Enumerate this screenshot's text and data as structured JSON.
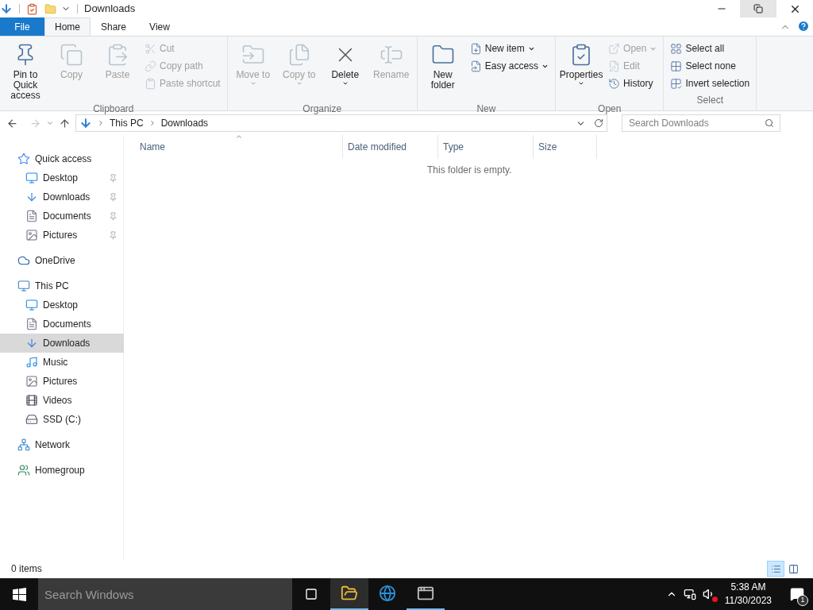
{
  "title_bar": {
    "title": "Downloads"
  },
  "ribbon_tabs": [
    {
      "label": "File",
      "kind": "file",
      "selected": false
    },
    {
      "label": "Home",
      "kind": "tab",
      "selected": true
    },
    {
      "label": "Share",
      "kind": "tab",
      "selected": false
    },
    {
      "label": "View",
      "kind": "tab",
      "selected": false
    }
  ],
  "ribbon_groups": [
    {
      "label": "Clipboard",
      "commands": [
        {
          "label": "Pin to Quick access",
          "kind": "large",
          "disabled": false,
          "dropdown": false
        },
        {
          "label": "Copy",
          "kind": "large",
          "disabled": true,
          "dropdown": false
        },
        {
          "label": "Paste",
          "kind": "large",
          "disabled": true,
          "dropdown": false
        },
        {
          "label": "Cut",
          "kind": "small",
          "disabled": true,
          "dropdown": false
        },
        {
          "label": "Copy path",
          "kind": "small",
          "disabled": true,
          "dropdown": false
        },
        {
          "label": "Paste shortcut",
          "kind": "small",
          "disabled": true,
          "dropdown": false
        }
      ]
    },
    {
      "label": "Organize",
      "commands": [
        {
          "label": "Move to",
          "kind": "large",
          "disabled": true,
          "dropdown": true
        },
        {
          "label": "Copy to",
          "kind": "large",
          "disabled": true,
          "dropdown": true
        },
        {
          "label": "Delete",
          "kind": "large",
          "disabled": false,
          "dropdown": true
        },
        {
          "label": "Rename",
          "kind": "large",
          "disabled": true,
          "dropdown": false
        }
      ]
    },
    {
      "label": "New",
      "commands": [
        {
          "label": "New folder",
          "kind": "large",
          "disabled": false,
          "dropdown": false
        },
        {
          "label": "New item",
          "kind": "small",
          "disabled": false,
          "dropdown": true
        },
        {
          "label": "Easy access",
          "kind": "small",
          "disabled": false,
          "dropdown": true
        }
      ]
    },
    {
      "label": "Open",
      "commands": [
        {
          "label": "Properties",
          "kind": "large",
          "disabled": false,
          "dropdown": true
        },
        {
          "label": "Open",
          "kind": "small",
          "disabled": true,
          "dropdown": true
        },
        {
          "label": "Edit",
          "kind": "small",
          "disabled": true,
          "dropdown": false
        },
        {
          "label": "History",
          "kind": "small",
          "disabled": false,
          "dropdown": false
        }
      ]
    },
    {
      "label": "Select",
      "commands": [
        {
          "label": "Select all",
          "kind": "small",
          "disabled": false,
          "dropdown": false
        },
        {
          "label": "Select none",
          "kind": "small",
          "disabled": false,
          "dropdown": false
        },
        {
          "label": "Invert selection",
          "kind": "small",
          "disabled": false,
          "dropdown": false
        }
      ]
    }
  ],
  "address_bar": {
    "crumbs": [
      "This PC",
      "Downloads"
    ]
  },
  "search": {
    "placeholder": "Search Downloads"
  },
  "columns": [
    "Name",
    "Date modified",
    "Type",
    "Size"
  ],
  "empty_message": "This folder is empty.",
  "navigation": [
    {
      "label": "Quick access",
      "selected": false,
      "children": [
        {
          "label": "Desktop",
          "pinned": true,
          "selected": false
        },
        {
          "label": "Downloads",
          "pinned": true,
          "selected": false
        },
        {
          "label": "Documents",
          "pinned": true,
          "selected": false
        },
        {
          "label": "Pictures",
          "pinned": true,
          "selected": false
        }
      ]
    },
    {
      "label": "OneDrive",
      "selected": false
    },
    {
      "label": "This PC",
      "selected": false,
      "children": [
        {
          "label": "Desktop",
          "pinned": false,
          "selected": false
        },
        {
          "label": "Documents",
          "pinned": false,
          "selected": false
        },
        {
          "label": "Downloads",
          "pinned": false,
          "selected": true
        },
        {
          "label": "Music",
          "pinned": false,
          "selected": false
        },
        {
          "label": "Pictures",
          "pinned": false,
          "selected": false
        },
        {
          "label": "Videos",
          "pinned": false,
          "selected": false
        },
        {
          "label": "SSD (C:)",
          "pinned": false,
          "selected": false
        }
      ]
    },
    {
      "label": "Network",
      "selected": false
    },
    {
      "label": "Homegroup",
      "selected": false
    }
  ],
  "status_bar": {
    "item_count": "0 items",
    "views": [
      {
        "selected": true
      },
      {
        "selected": false
      }
    ]
  },
  "taskbar": {
    "search_placeholder": "Search Windows",
    "apps": [
      {
        "active": true,
        "running": true
      },
      {
        "active": false,
        "running": false
      },
      {
        "active": false,
        "running": true
      }
    ],
    "time": "5:38 AM",
    "date": "11/30/2023",
    "notification_count": "1"
  }
}
